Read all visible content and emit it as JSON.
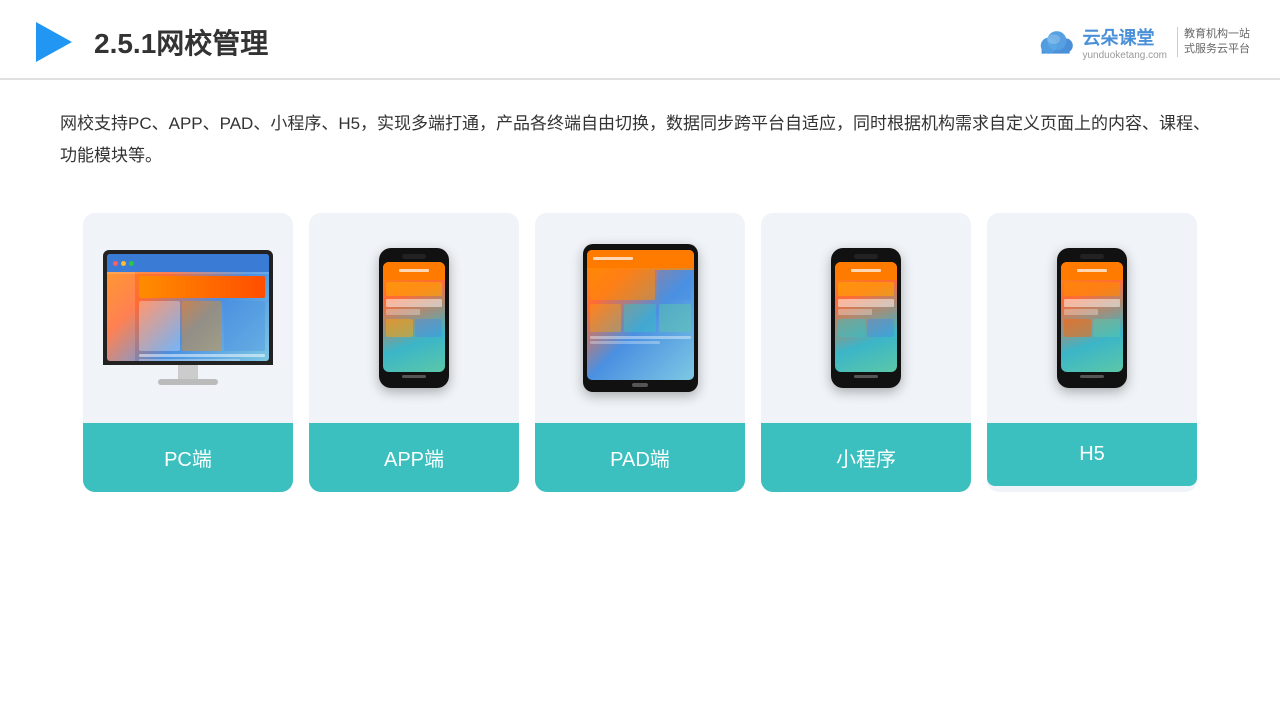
{
  "header": {
    "section_number": "2.5.1",
    "title": "网校管理",
    "logo": {
      "name": "云朵课堂",
      "url": "yunduoketang.com",
      "tagline": "教育机构一站\n式服务云平台"
    }
  },
  "description": {
    "text": "网校支持PC、APP、PAD、小程序、H5，实现多端打通，产品各终端自由切换，数据同步跨平台自适应，同时根据机构需求自定义页面上的内容、课程、功能模块等。"
  },
  "devices": [
    {
      "id": "pc",
      "label": "PC端",
      "type": "pc"
    },
    {
      "id": "app",
      "label": "APP端",
      "type": "phone"
    },
    {
      "id": "pad",
      "label": "PAD端",
      "type": "tablet"
    },
    {
      "id": "miniprogram",
      "label": "小程序",
      "type": "phone"
    },
    {
      "id": "h5",
      "label": "H5",
      "type": "phone"
    }
  ],
  "accent_color": "#3bbfbf"
}
